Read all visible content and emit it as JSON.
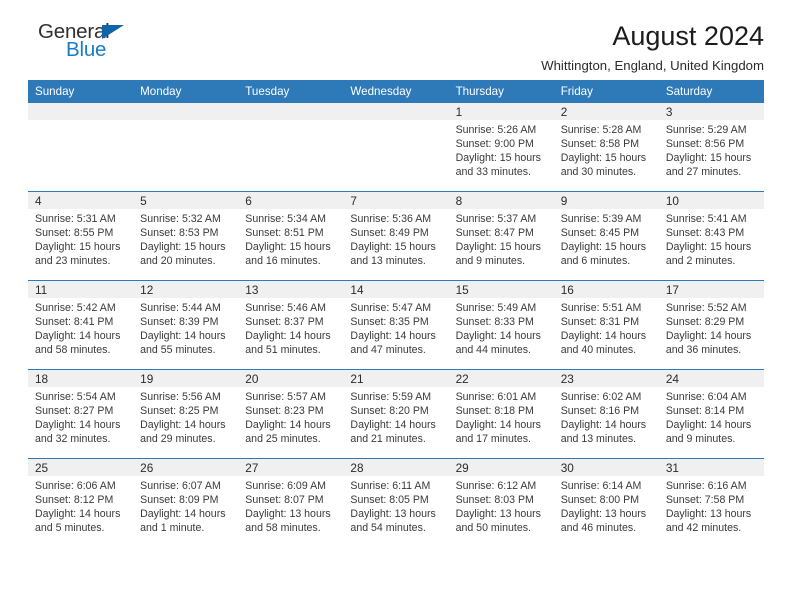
{
  "brand": {
    "name_part1": "General",
    "name_part2": "Blue",
    "triangle_color": "#1064a8",
    "blue_text_color": "#1a7dc4"
  },
  "header": {
    "title": "August 2024",
    "subtitle": "Whittington, England, United Kingdom"
  },
  "theme": {
    "header_blue": "#2e79b8",
    "daynum_band": "#f0f0f0",
    "text": "#2b2b2b"
  },
  "labels": {
    "sunrise_prefix": "Sunrise:",
    "sunset_prefix": "Sunset:",
    "daylight_prefix": "Daylight:"
  },
  "columns": [
    "Sunday",
    "Monday",
    "Tuesday",
    "Wednesday",
    "Thursday",
    "Friday",
    "Saturday"
  ],
  "weeks": [
    [
      {
        "day": "",
        "empty": true,
        "l1": "",
        "l2": "",
        "l3": "",
        "l4": ""
      },
      {
        "day": "",
        "empty": true,
        "l1": "",
        "l2": "",
        "l3": "",
        "l4": ""
      },
      {
        "day": "",
        "empty": true,
        "l1": "",
        "l2": "",
        "l3": "",
        "l4": ""
      },
      {
        "day": "",
        "empty": true,
        "l1": "",
        "l2": "",
        "l3": "",
        "l4": ""
      },
      {
        "day": "1",
        "l1": "Sunrise: 5:26 AM",
        "l2": "Sunset: 9:00 PM",
        "l3": "Daylight: 15 hours",
        "l4": "and 33 minutes."
      },
      {
        "day": "2",
        "l1": "Sunrise: 5:28 AM",
        "l2": "Sunset: 8:58 PM",
        "l3": "Daylight: 15 hours",
        "l4": "and 30 minutes."
      },
      {
        "day": "3",
        "l1": "Sunrise: 5:29 AM",
        "l2": "Sunset: 8:56 PM",
        "l3": "Daylight: 15 hours",
        "l4": "and 27 minutes."
      }
    ],
    [
      {
        "day": "4",
        "l1": "Sunrise: 5:31 AM",
        "l2": "Sunset: 8:55 PM",
        "l3": "Daylight: 15 hours",
        "l4": "and 23 minutes."
      },
      {
        "day": "5",
        "l1": "Sunrise: 5:32 AM",
        "l2": "Sunset: 8:53 PM",
        "l3": "Daylight: 15 hours",
        "l4": "and 20 minutes."
      },
      {
        "day": "6",
        "l1": "Sunrise: 5:34 AM",
        "l2": "Sunset: 8:51 PM",
        "l3": "Daylight: 15 hours",
        "l4": "and 16 minutes."
      },
      {
        "day": "7",
        "l1": "Sunrise: 5:36 AM",
        "l2": "Sunset: 8:49 PM",
        "l3": "Daylight: 15 hours",
        "l4": "and 13 minutes."
      },
      {
        "day": "8",
        "l1": "Sunrise: 5:37 AM",
        "l2": "Sunset: 8:47 PM",
        "l3": "Daylight: 15 hours",
        "l4": "and 9 minutes."
      },
      {
        "day": "9",
        "l1": "Sunrise: 5:39 AM",
        "l2": "Sunset: 8:45 PM",
        "l3": "Daylight: 15 hours",
        "l4": "and 6 minutes."
      },
      {
        "day": "10",
        "l1": "Sunrise: 5:41 AM",
        "l2": "Sunset: 8:43 PM",
        "l3": "Daylight: 15 hours",
        "l4": "and 2 minutes."
      }
    ],
    [
      {
        "day": "11",
        "l1": "Sunrise: 5:42 AM",
        "l2": "Sunset: 8:41 PM",
        "l3": "Daylight: 14 hours",
        "l4": "and 58 minutes."
      },
      {
        "day": "12",
        "l1": "Sunrise: 5:44 AM",
        "l2": "Sunset: 8:39 PM",
        "l3": "Daylight: 14 hours",
        "l4": "and 55 minutes."
      },
      {
        "day": "13",
        "l1": "Sunrise: 5:46 AM",
        "l2": "Sunset: 8:37 PM",
        "l3": "Daylight: 14 hours",
        "l4": "and 51 minutes."
      },
      {
        "day": "14",
        "l1": "Sunrise: 5:47 AM",
        "l2": "Sunset: 8:35 PM",
        "l3": "Daylight: 14 hours",
        "l4": "and 47 minutes."
      },
      {
        "day": "15",
        "l1": "Sunrise: 5:49 AM",
        "l2": "Sunset: 8:33 PM",
        "l3": "Daylight: 14 hours",
        "l4": "and 44 minutes."
      },
      {
        "day": "16",
        "l1": "Sunrise: 5:51 AM",
        "l2": "Sunset: 8:31 PM",
        "l3": "Daylight: 14 hours",
        "l4": "and 40 minutes."
      },
      {
        "day": "17",
        "l1": "Sunrise: 5:52 AM",
        "l2": "Sunset: 8:29 PM",
        "l3": "Daylight: 14 hours",
        "l4": "and 36 minutes."
      }
    ],
    [
      {
        "day": "18",
        "l1": "Sunrise: 5:54 AM",
        "l2": "Sunset: 8:27 PM",
        "l3": "Daylight: 14 hours",
        "l4": "and 32 minutes."
      },
      {
        "day": "19",
        "l1": "Sunrise: 5:56 AM",
        "l2": "Sunset: 8:25 PM",
        "l3": "Daylight: 14 hours",
        "l4": "and 29 minutes."
      },
      {
        "day": "20",
        "l1": "Sunrise: 5:57 AM",
        "l2": "Sunset: 8:23 PM",
        "l3": "Daylight: 14 hours",
        "l4": "and 25 minutes."
      },
      {
        "day": "21",
        "l1": "Sunrise: 5:59 AM",
        "l2": "Sunset: 8:20 PM",
        "l3": "Daylight: 14 hours",
        "l4": "and 21 minutes."
      },
      {
        "day": "22",
        "l1": "Sunrise: 6:01 AM",
        "l2": "Sunset: 8:18 PM",
        "l3": "Daylight: 14 hours",
        "l4": "and 17 minutes."
      },
      {
        "day": "23",
        "l1": "Sunrise: 6:02 AM",
        "l2": "Sunset: 8:16 PM",
        "l3": "Daylight: 14 hours",
        "l4": "and 13 minutes."
      },
      {
        "day": "24",
        "l1": "Sunrise: 6:04 AM",
        "l2": "Sunset: 8:14 PM",
        "l3": "Daylight: 14 hours",
        "l4": "and 9 minutes."
      }
    ],
    [
      {
        "day": "25",
        "l1": "Sunrise: 6:06 AM",
        "l2": "Sunset: 8:12 PM",
        "l3": "Daylight: 14 hours",
        "l4": "and 5 minutes."
      },
      {
        "day": "26",
        "l1": "Sunrise: 6:07 AM",
        "l2": "Sunset: 8:09 PM",
        "l3": "Daylight: 14 hours",
        "l4": "and 1 minute."
      },
      {
        "day": "27",
        "l1": "Sunrise: 6:09 AM",
        "l2": "Sunset: 8:07 PM",
        "l3": "Daylight: 13 hours",
        "l4": "and 58 minutes."
      },
      {
        "day": "28",
        "l1": "Sunrise: 6:11 AM",
        "l2": "Sunset: 8:05 PM",
        "l3": "Daylight: 13 hours",
        "l4": "and 54 minutes."
      },
      {
        "day": "29",
        "l1": "Sunrise: 6:12 AM",
        "l2": "Sunset: 8:03 PM",
        "l3": "Daylight: 13 hours",
        "l4": "and 50 minutes."
      },
      {
        "day": "30",
        "l1": "Sunrise: 6:14 AM",
        "l2": "Sunset: 8:00 PM",
        "l3": "Daylight: 13 hours",
        "l4": "and 46 minutes."
      },
      {
        "day": "31",
        "l1": "Sunrise: 6:16 AM",
        "l2": "Sunset: 7:58 PM",
        "l3": "Daylight: 13 hours",
        "l4": "and 42 minutes."
      }
    ]
  ]
}
